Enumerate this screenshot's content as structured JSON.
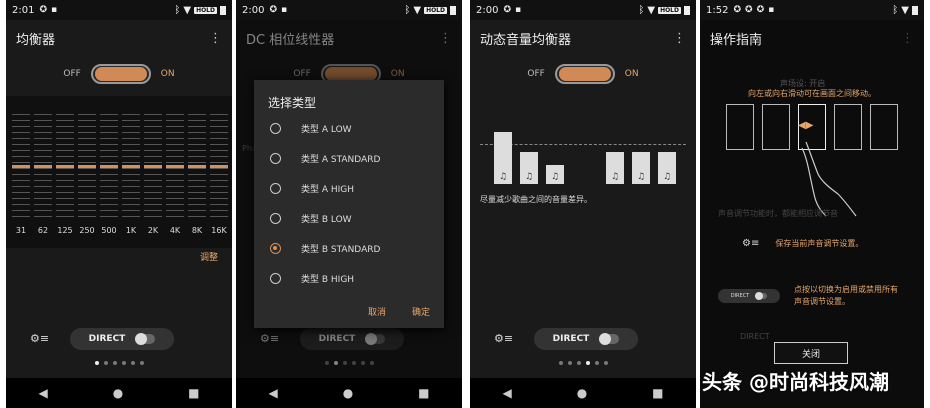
{
  "screen1": {
    "status": {
      "time": "2:01",
      "hold": "HOLD"
    },
    "title": "均衡器",
    "toggle": {
      "off": "OFF",
      "on": "ON"
    },
    "eq": {
      "frequencies": [
        "31",
        "62",
        "125",
        "250",
        "500",
        "1K",
        "2K",
        "4K",
        "8K",
        "16K"
      ],
      "levels": [
        0,
        0,
        0,
        0,
        0,
        0,
        0,
        0,
        0,
        0
      ]
    },
    "adjust_label": "调整",
    "direct_label": "DIRECT",
    "page_dots": {
      "count": 6,
      "active": 0
    }
  },
  "screen2": {
    "status": {
      "time": "2:00",
      "hold": "HOLD"
    },
    "title": "DC 相位线性器",
    "toggle": {
      "off": "OFF",
      "on": "ON"
    },
    "bg_phase": "Phase",
    "dialog": {
      "title": "选择类型",
      "options": [
        {
          "label": "类型 A LOW",
          "selected": false
        },
        {
          "label": "类型 A STANDARD",
          "selected": false
        },
        {
          "label": "类型 A HIGH",
          "selected": false
        },
        {
          "label": "类型 B LOW",
          "selected": false
        },
        {
          "label": "类型 B STANDARD",
          "selected": true
        },
        {
          "label": "类型 B HIGH",
          "selected": false
        }
      ],
      "cancel": "取消",
      "ok": "确定"
    },
    "direct_label": "DIRECT",
    "page_dots": {
      "count": 6,
      "active": 1
    }
  },
  "screen3": {
    "status": {
      "time": "2:00",
      "hold": "HOLD"
    },
    "title": "动态音量均衡器",
    "toggle": {
      "off": "OFF",
      "on": "ON"
    },
    "bars": [
      {
        "level": 0.82,
        "icon": "♫"
      },
      {
        "level": 0.5,
        "icon": "♫"
      },
      {
        "level": 0.3,
        "icon": "♫"
      },
      {
        "level": 0.5,
        "icon": "♫"
      },
      {
        "level": 0.5,
        "icon": "♫"
      },
      {
        "level": 0.5,
        "icon": "♫"
      }
    ],
    "description": "尽量减少歌曲之间的音量差异。",
    "direct_label": "DIRECT",
    "page_dots": {
      "count": 6,
      "active": 3
    }
  },
  "screen4": {
    "status": {
      "time": "1:52"
    },
    "title": "操作指南",
    "ghost_top": "声场设: 开启",
    "hint": "向左或向右滑动可在画面之间移动。",
    "ghost_mid": "声音调节功能时，都能相应调节音",
    "save_text": "保存当前声音调节设置。",
    "direct_label": "DIRECT",
    "toggle_text": "点按以切换为启用或禁用所有声音调节设置。",
    "ghost_bottom": "DIRECT",
    "close_label": "关闭"
  },
  "watermark": "头条 @时尚科技风潮"
}
